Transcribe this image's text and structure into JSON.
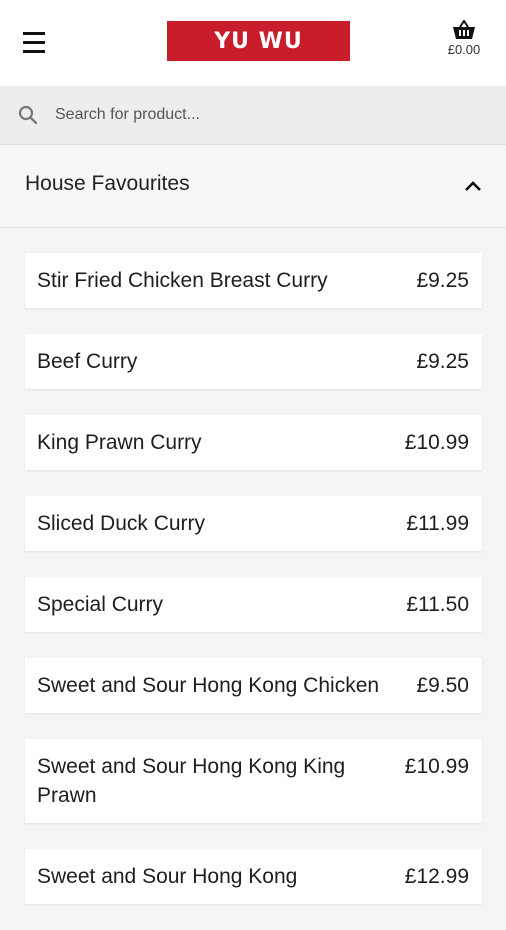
{
  "header": {
    "logo_text": "YU WU",
    "basket_total": "£0.00"
  },
  "search": {
    "placeholder": "Search for product..."
  },
  "category": {
    "title": "House Favourites"
  },
  "products": [
    {
      "name": "Stir Fried Chicken Breast Curry",
      "price": "£9.25"
    },
    {
      "name": "Beef Curry",
      "price": "£9.25"
    },
    {
      "name": "King Prawn Curry",
      "price": "£10.99"
    },
    {
      "name": "Sliced Duck Curry",
      "price": "£11.99"
    },
    {
      "name": "Special Curry",
      "price": "£11.50"
    },
    {
      "name": "Sweet and Sour Hong Kong Chicken",
      "price": "£9.50"
    },
    {
      "name": "Sweet and Sour Hong Kong King Prawn",
      "price": "£10.99"
    },
    {
      "name": "Sweet and Sour Hong Kong",
      "price": "£12.99"
    }
  ],
  "colors": {
    "brand_red": "#c91d2b",
    "background": "#f4f4f4"
  }
}
